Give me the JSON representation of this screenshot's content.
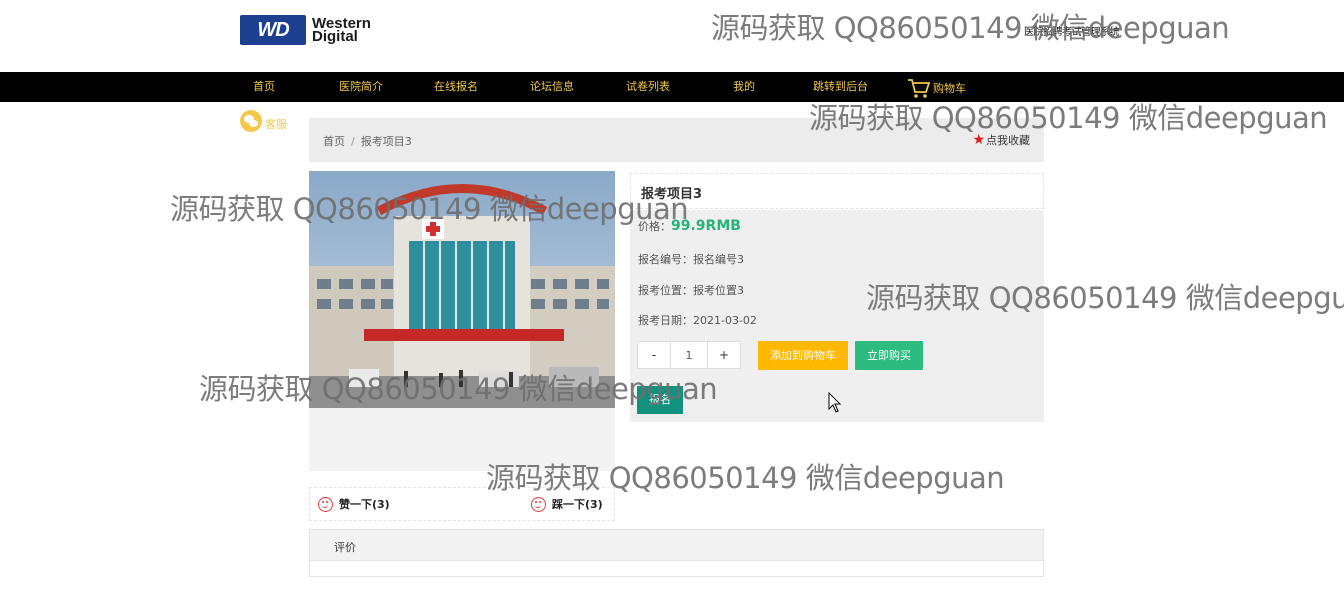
{
  "header": {
    "logo_mark": "WD",
    "logo_line1": "Western",
    "logo_line2": "Digital",
    "site_title": "医院招聘考试管理系统"
  },
  "nav": {
    "items": [
      "首页",
      "医院简介",
      "在线报名",
      "论坛信息",
      "试卷列表",
      "我的",
      "跳转到后台"
    ],
    "cart_label": "购物车"
  },
  "service": {
    "label": "客服"
  },
  "breadcrumb": {
    "home": "首页",
    "separator": "/",
    "current": "报考项目3"
  },
  "favorite": {
    "label": "点我收藏"
  },
  "product": {
    "title": "报考项目3",
    "price_label": "价格：",
    "price_value": "99.9RMB",
    "fields": [
      {
        "label": "报名编号：",
        "value": "报名编号3"
      },
      {
        "label": "报考位置：",
        "value": "报考位置3"
      },
      {
        "label": "报考日期：",
        "value": "2021-03-02"
      }
    ],
    "quantity": "1",
    "minus": "-",
    "plus": "+",
    "add_cart": "添加到购物车",
    "buy_now": "立即购买",
    "register": "报名"
  },
  "likes": {
    "up": "赞一下(3)",
    "down": "踩一下(3)"
  },
  "review": {
    "tab": "评价"
  },
  "watermark": "源码获取 QQ86050149 微信deepguan",
  "colors": {
    "nav_bg": "#000000",
    "nav_text": "#f2c94c",
    "price": "#26b37a",
    "cart_btn": "#ffb800",
    "buy_btn": "#2dbc7f",
    "register_btn": "#12917e",
    "star": "#e41b1b"
  }
}
